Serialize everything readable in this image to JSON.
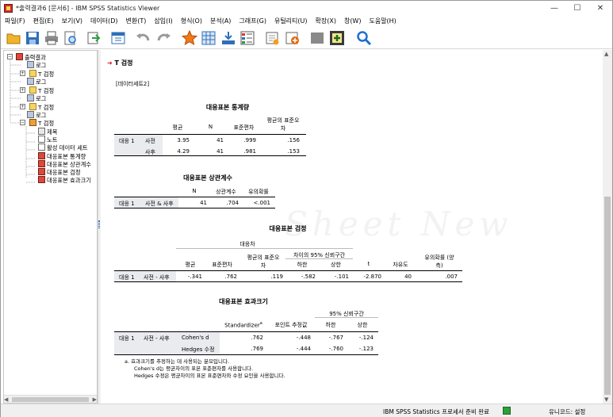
{
  "window": {
    "title": "*출력결과6 [문서6] - IBM SPSS Statistics Viewer",
    "controls": [
      "—",
      "☐",
      "✕"
    ]
  },
  "menu": [
    "파일(F)",
    "편집(E)",
    "보기(V)",
    "데이터(D)",
    "변환(T)",
    "삽입(I)",
    "형식(O)",
    "분석(A)",
    "그래프(G)",
    "유틸리티(U)",
    "확장(X)",
    "창(W)",
    "도움말(H)"
  ],
  "toolbar": {
    "icons": [
      "open-icon",
      "save-icon",
      "print-icon",
      "print-preview-icon",
      "export-icon",
      "goto-data-icon",
      "undo-icon",
      "redo-icon",
      "goto-case-icon",
      "goto-variable-icon",
      "select-cases-icon",
      "variables-icon",
      "show-hide-icon",
      "designate-window-icon",
      "promote-icon",
      "collapse-icon",
      "insert-output-icon",
      "search-icon"
    ]
  },
  "tree": {
    "items": [
      {
        "label": "출력결과",
        "icon": "log"
      },
      {
        "label": "로그",
        "icon": "log"
      },
      {
        "label": "T 검정",
        "icon": "fold"
      },
      {
        "label": "로그",
        "icon": "log"
      },
      {
        "label": "T 검정",
        "icon": "fold"
      },
      {
        "label": "로그",
        "icon": "log"
      },
      {
        "label": "T 검정",
        "icon": "fold"
      },
      {
        "label": "로그",
        "icon": "log"
      },
      {
        "label": "T 검정",
        "icon": "foldr"
      },
      {
        "label": "제목",
        "icon": "title"
      },
      {
        "label": "노트",
        "icon": "note"
      },
      {
        "label": "활성 데이터 세트",
        "icon": "note"
      },
      {
        "label": "대응표본 통계량",
        "icon": "tbl"
      },
      {
        "label": "대응표본 상관계수",
        "icon": "tbl"
      },
      {
        "label": "대응표본 검정",
        "icon": "tbl"
      },
      {
        "label": "대응표본 효과크기",
        "icon": "tbl"
      }
    ]
  },
  "output": {
    "heading": "T 검정",
    "dataset": "[데이터세트2]",
    "watermark": "Sheet New",
    "stats": {
      "title": "대응표본 통계량",
      "headers": [
        "평균",
        "N",
        "표준편차",
        "평균의 표준오\n차"
      ],
      "pair": "대응 1",
      "rows": [
        {
          "label": "사전",
          "values": [
            "3.95",
            "41",
            ".999",
            ".156"
          ]
        },
        {
          "label": "사후",
          "values": [
            "4.29",
            "41",
            ".981",
            ".153"
          ]
        }
      ]
    },
    "corr": {
      "title": "대응표본 상관계수",
      "headers": [
        "N",
        "상관계수",
        "유의확률"
      ],
      "pair": "대응 1",
      "label": "사전 & 사후",
      "values": [
        "41",
        ".704",
        "<.001"
      ]
    },
    "test": {
      "title": "대응표본 검정",
      "group": "대응차",
      "ci": "차이의 95% 신뢰구간",
      "headers": [
        "평균",
        "표준편차",
        "평균의 표준오\n차",
        "하한",
        "상한",
        "t",
        "자유도",
        "유의확률 (양\n측)"
      ],
      "pair": "대응 1",
      "label": "사전 - 사후",
      "values": [
        "-.341",
        ".762",
        ".119",
        "-.582",
        "-.101",
        "-2.870",
        "40",
        ".007"
      ]
    },
    "effect": {
      "title": "대응표본 효과크기",
      "ci": "95% 신뢰구간",
      "headers": [
        "Standardizer",
        "포인트 추정값",
        "하한",
        "상한"
      ],
      "sup": "a",
      "pair": "대응 1",
      "label": "사전 - 사후",
      "rows": [
        {
          "label": "Cohen's d",
          "values": [
            ".762",
            "-.448",
            "-.767",
            "-.124"
          ]
        },
        {
          "label": "Hedges 수정",
          "values": [
            ".769",
            "-.444",
            "-.760",
            "-.123"
          ]
        }
      ],
      "footnotes": [
        "a. 효과크기를 추정하는 데 사용되는 분모입니다.",
        "Cohen's d는 평균차이의 표본 표준편차를 사용합니다.",
        "Hedges 수정은 평균차이의 표본 표준편차와 수정 요인을 사용합니다."
      ]
    }
  },
  "status": {
    "processor": "IBM SPSS Statistics 프로세서 준비 완료",
    "encoding": "유니코드: 설정"
  },
  "colors": {
    "accent": "#e02020",
    "label_bg": "#e9ebef",
    "toolbar_blue": "#1f6fd1"
  }
}
